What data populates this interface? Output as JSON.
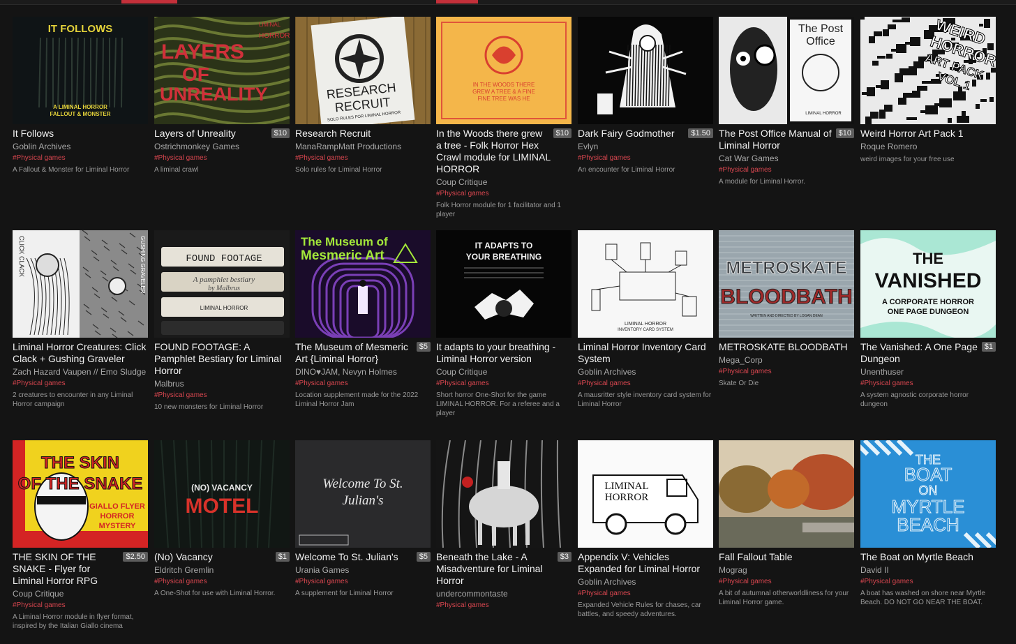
{
  "cards": [
    {
      "title": "It Follows",
      "price": "",
      "author": "Goblin Archives",
      "tag": "#Physical games",
      "desc": "A Fallout & Monster for Liminal Horror",
      "cover": "It Follows cover",
      "cover_lines": [
        "IT FOLLOWS",
        "A LIMINAL HORROR",
        "FALLOUT & MONSTER"
      ]
    },
    {
      "title": "Layers of Unreality",
      "price": "$10",
      "author": "Ostrichmonkey Games",
      "tag": "#Physical games",
      "desc": "A liminal crawl",
      "cover": "Layers of Unreality cover",
      "cover_lines": [
        "LAYERS",
        "OF",
        "UNREALITY",
        "LIMINAL",
        "HORROR"
      ]
    },
    {
      "title": "Research Recruit",
      "price": "",
      "author": "ManaRampMatt Productions",
      "tag": "#Physical games",
      "desc": "Solo rules for Liminal Horror",
      "cover": "Research Recruit cover",
      "cover_lines": [
        "RESEARCH",
        "RECRUIT",
        "SOLO RULES FOR LIMINAL HORROR"
      ]
    },
    {
      "title": "In the Woods there grew a tree - Folk Horror Hex Crawl module for LIMINAL HORROR",
      "price": "$10",
      "author": "Coup Critique",
      "tag": "#Physical games",
      "desc": "Folk Horror module for 1 facilitator and 1 player",
      "cover": "In the Woods cover",
      "cover_lines": [
        "IN THE WOODS THERE",
        "GREW A TREE & A FINE",
        "FINE TREE WAS HE"
      ]
    },
    {
      "title": "Dark Fairy Godmother",
      "price": "$1.50",
      "author": "Evlyn",
      "tag": "#Physical games",
      "desc": "An encounter for Liminal Horror",
      "cover": "Dark Fairy Godmother cover",
      "cover_lines": []
    },
    {
      "title": "The Post Office Manual of Liminal Horror",
      "price": "$10",
      "author": "Cat War Games",
      "tag": "#Physical games",
      "desc": "A module for Liminal Horror.",
      "cover": "The Post Office cover",
      "cover_lines": [
        "The Post",
        "Office",
        "LIMINAL HORROR"
      ]
    },
    {
      "title": "Weird Horror Art Pack 1",
      "price": "",
      "author": "Roque Romero",
      "tag": "",
      "desc": "weird images for your free use",
      "cover": "Weird Horror Art Pack cover",
      "cover_lines": [
        "WEIRD",
        "HORROR",
        "ART PACK",
        "VOL 1"
      ]
    },
    {
      "title": "Liminal Horror Creatures: Click Clack + Gushing Graveler",
      "price": "",
      "author": "Zach Hazard Vaupen // Emo Sludge",
      "tag": "#Physical games",
      "desc": "2 creatures to encounter in any Liminal Horror campaign",
      "cover": "Click Clack cover",
      "cover_lines": [
        "CLICK CLACK",
        "GUSHING GRAVELER"
      ]
    },
    {
      "title": "FOUND FOOTAGE: A Pamphlet Bestiary for Liminal Horror",
      "price": "",
      "author": "Malbrus",
      "tag": "#Physical games",
      "desc": "10 new monsters for Liminal Horror",
      "cover": "Found Footage cover",
      "cover_lines": [
        "FOUND FOOTAGE",
        "A pamphlet bestiary",
        "by Malbrus",
        "LIMINAL HORROR"
      ]
    },
    {
      "title": "The Museum of Mesmeric Art {Liminal Horror}",
      "price": "$5",
      "author": "DINO♥JAM, Nevyn Holmes",
      "tag": "#Physical games",
      "desc": "Location supplement made for the 2022 Liminal Horror Jam",
      "cover": "Museum of Mesmeric Art cover",
      "cover_lines": [
        "The Museum of",
        "Mesmeric Art"
      ]
    },
    {
      "title": "It adapts to your breathing - Liminal Horror version",
      "price": "",
      "author": "Coup Critique",
      "tag": "#Physical games",
      "desc": "Short horror One-Shot for the game LIMINAL HORROR. For a referee and a player",
      "cover": "It adapts cover",
      "cover_lines": [
        "IT ADAPTS TO",
        "YOUR BREATHING"
      ]
    },
    {
      "title": "Liminal Horror Inventory Card System",
      "price": "",
      "author": "Goblin Archives",
      "tag": "#Physical games",
      "desc": "A mausritter style inventory card system for Liminal Horror",
      "cover": "Inventory Card System cover",
      "cover_lines": [
        "LIMINAL HORROR",
        "INVENTORY CARD SYSTEM"
      ]
    },
    {
      "title": "METROSKATE BLOODBATH",
      "price": "",
      "author": "Mega_Corp",
      "tag": "#Physical games",
      "desc": "Skate Or Die",
      "cover": "Metroskate Bloodbath cover",
      "cover_lines": [
        "METROSKATE",
        "BLOODBATH",
        "WRITTEN AND DIRECTED BY LOGAN DEAN"
      ]
    },
    {
      "title": "The Vanished: A One Page Dungeon",
      "price": "$1",
      "author": "Unenthuser",
      "tag": "#Physical games",
      "desc": "A system agnostic corporate horror dungeon",
      "cover": "The Vanished cover",
      "cover_lines": [
        "THE",
        "VANISHED",
        "A CORPORATE HORROR",
        "ONE PAGE DUNGEON"
      ]
    },
    {
      "title": "THE SKIN OF THE SNAKE - Flyer for Liminal Horror RPG",
      "price": "$2.50",
      "author": "Coup Critique",
      "tag": "#Physical games",
      "desc": "A Liminal Horror module in flyer format, inspired by the Italian Giallo cinema",
      "cover": "The Skin of the Snake cover",
      "cover_lines": [
        "THE SKIN",
        "OF THE SNAKE",
        "GIALLO FLYER",
        "HORROR",
        "MYSTERY"
      ]
    },
    {
      "title": "(No) Vacancy",
      "price": "$1",
      "author": "Eldritch Gremlin",
      "tag": "#Physical games",
      "desc": "A One-Shot for use with Liminal Horror.",
      "cover": "No Vacancy cover",
      "cover_lines": [
        "(NO) VACANCY",
        "MOTEL"
      ]
    },
    {
      "title": "Welcome To St. Julian's",
      "price": "$5",
      "author": "Urania Games",
      "tag": "#Physical games",
      "desc": "A supplement for Liminal Horror",
      "cover": "Welcome To St. Julian's cover",
      "cover_lines": [
        "Welcome To St.",
        "Julian's"
      ]
    },
    {
      "title": "Beneath the Lake - A Misadventure for Liminal Horror",
      "price": "$3",
      "author": "undercommontaste",
      "tag": "#Physical games",
      "desc": "",
      "cover": "Beneath the Lake cover",
      "cover_lines": []
    },
    {
      "title": "Appendix V: Vehicles Expanded for Liminal Horror",
      "price": "",
      "author": "Goblin Archives",
      "tag": "#Physical games",
      "desc": "Expanded Vehicle Rules for chases, car battles, and speedy adventures.",
      "cover": "Appendix V Vehicles cover",
      "cover_lines": [
        "LIMINAL",
        "HORROR"
      ]
    },
    {
      "title": "Fall Fallout Table",
      "price": "",
      "author": "Mograg",
      "tag": "#Physical games",
      "desc": "A bit of autumnal otherworldliness for your Liminal Horror game.",
      "cover": "Fall Fallout Table cover",
      "cover_lines": []
    },
    {
      "title": "The Boat on Myrtle Beach",
      "price": "",
      "author": "David II",
      "tag": "#Physical games",
      "desc": "A boat has washed on shore near Myrtle Beach. DO NOT GO NEAR THE BOAT.",
      "cover": "The Boat on Myrtle Beach cover",
      "cover_lines": [
        "THE",
        "BOAT",
        "ON",
        "MYRTLE",
        "BEACH"
      ]
    }
  ]
}
